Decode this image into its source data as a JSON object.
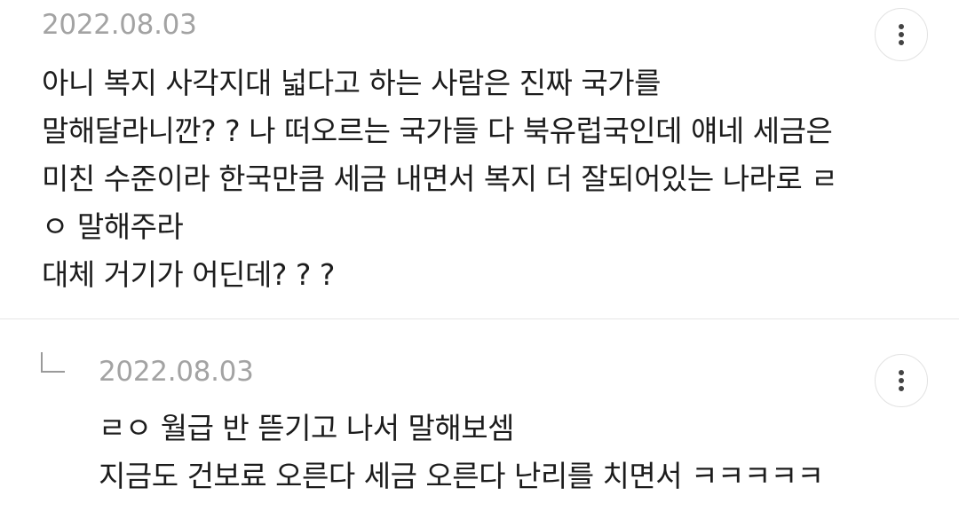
{
  "comments": [
    {
      "date": "2022.08.03",
      "lines": [
        "아니 복지 사각지대 넓다고 하는 사람은 진짜 국가를",
        "말해달라니깐? ?  나 떠오르는 국가들 다 북유럽국인데 얘네 세금은",
        "미친 수준이라 한국만큼 세금 내면서 복지 더 잘되어있는 나라로 ㄹ",
        "ㅇ 말해주라",
        "대체 거기가 어딘데? ? ?"
      ],
      "more_icon": "more-vertical-icon"
    },
    {
      "date": "2022.08.03",
      "is_reply": true,
      "reply_icon": "reply-arrow-icon",
      "lines": [
        "ㄹㅇ 월급 반 뜯기고 나서 말해보셈",
        "지금도 건보료 오른다 세금 오른다 난리를 치면서 ㅋㅋㅋㅋㅋ"
      ],
      "more_icon": "more-vertical-icon"
    }
  ]
}
